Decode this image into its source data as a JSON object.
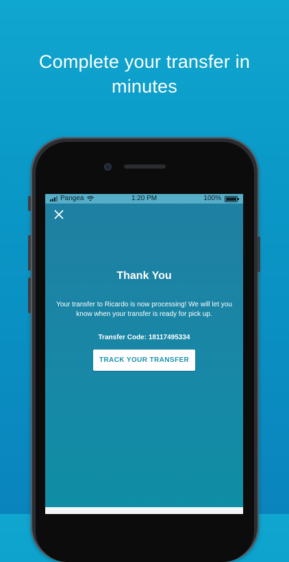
{
  "headline": {
    "line1": "Complete your transfer in",
    "line2": "minutes"
  },
  "status_bar": {
    "carrier": "Pangea",
    "time": "1:20 PM",
    "battery": "100%"
  },
  "screen": {
    "title": "Thank You",
    "message": "Your transfer to Ricardo is now processing! We will let you know when your transfer is ready for pick up.",
    "transfer_code": "Transfer Code: 18117495334",
    "track_button_label": "TRACK YOUR TRANSFER"
  },
  "icons": {
    "close": "close-icon",
    "signal": "signal-icon",
    "wifi": "wifi-icon",
    "battery": "battery-icon"
  },
  "colors": {
    "background_top": "#0fa6cf",
    "background_bottom": "#0a84bd",
    "accent": "#1a8fae",
    "button_bg": "#ffffff"
  }
}
